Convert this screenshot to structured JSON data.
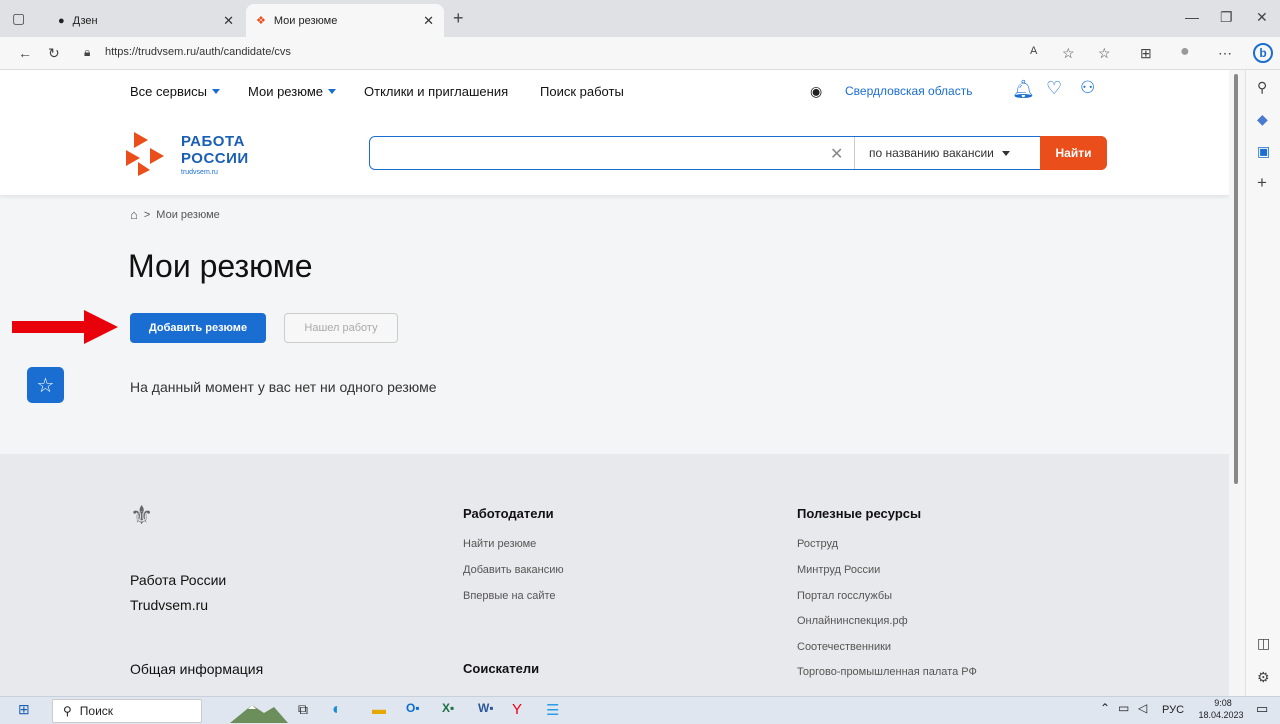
{
  "browser": {
    "tabs": [
      {
        "title": "Дзен",
        "active": false
      },
      {
        "title": "Мои резюме",
        "active": true
      }
    ],
    "url": "https://trudvsem.ru/auth/candidate/cvs"
  },
  "top_nav": {
    "all_services": "Все сервисы",
    "my_resumes": "Мои резюме",
    "responses": "Отклики и приглашения",
    "job_search": "Поиск работы",
    "region": "Свердловская область"
  },
  "logo": {
    "line1": "РАБОТА",
    "line2": "РОССИИ",
    "domain": "trudvsem.ru"
  },
  "search": {
    "placeholder": "",
    "mode": "по названию вакансии",
    "button": "Найти"
  },
  "breadcrumb": {
    "current": "Мои резюме",
    "separator": ">"
  },
  "page_title": "Мои резюме",
  "actions": {
    "add_resume": "Добавить резюме",
    "found_job": "Нашел работу"
  },
  "empty_message": "На данный момент у вас нет ни одного резюме",
  "footer": {
    "brand": {
      "line1": "Работа России",
      "line2": "Trudvsem.ru"
    },
    "general_info": "Общая информация",
    "employers": {
      "title": "Работодатели",
      "links": [
        "Найти резюме",
        "Добавить вакансию",
        "Впервые на сайте"
      ]
    },
    "seekers": {
      "title": "Соискатели"
    },
    "resources": {
      "title": "Полезные ресурсы",
      "links": [
        "Роструд",
        "Минтруд России",
        "Портал госслужбы",
        "Онлайнинспекция.рф",
        "Соотечественники",
        "Торгово-промышленная палата РФ"
      ]
    }
  },
  "taskbar": {
    "search": "Поиск",
    "lang": "РУС",
    "time": "9:08",
    "date": "18.04.2023"
  },
  "colors": {
    "brand_blue": "#1a6ed1",
    "brand_orange": "#e94e1b",
    "arrow_red": "#e8000a"
  }
}
